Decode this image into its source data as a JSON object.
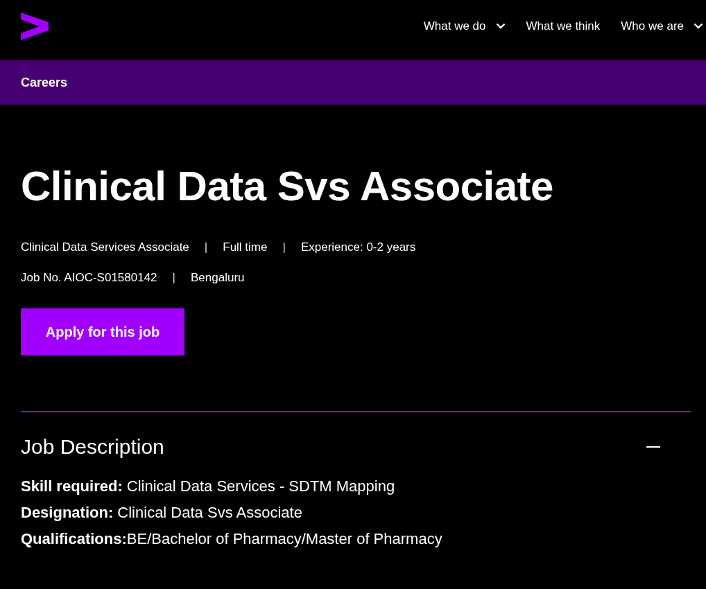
{
  "header": {
    "nav": [
      {
        "label": "What we do",
        "has_dropdown": true
      },
      {
        "label": "What we think",
        "has_dropdown": false
      },
      {
        "label": "Who we are",
        "has_dropdown": true
      }
    ]
  },
  "section_bar": {
    "label": "Careers"
  },
  "job": {
    "title": "Clinical Data Svs Associate",
    "meta_lines": [
      {
        "items": [
          {
            "kind": "text",
            "text": "Clinical Data Services Associate"
          },
          {
            "kind": "separator",
            "text": "|"
          },
          {
            "kind": "text",
            "text": "Full time"
          },
          {
            "kind": "separator",
            "text": "|"
          },
          {
            "kind": "text",
            "text": "Experience: 0-2 years"
          }
        ]
      },
      {
        "items": [
          {
            "kind": "text",
            "text": "Job No. AIOC-S01580142"
          },
          {
            "kind": "separator",
            "text": "|"
          },
          {
            "kind": "text",
            "text": "Bengaluru"
          }
        ]
      }
    ],
    "apply_button": "Apply for this job"
  },
  "accordion": {
    "title": "Job Description",
    "expanded": true,
    "lines": [
      "**Skill required:** Clinical Data Services - SDTM Mapping",
      "**Designation:** Clinical Data Svs Associate",
      "**Qualifications:**BE/Bachelor of Pharmacy/Master of Pharmacy"
    ]
  }
}
